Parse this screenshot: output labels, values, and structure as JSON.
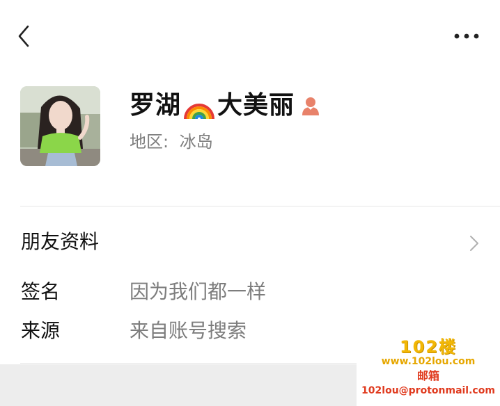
{
  "topbar": {
    "back_icon": "chevron-left-icon",
    "more_icon": "more-dots-icon"
  },
  "profile": {
    "nickname_part1": "罗湖",
    "nickname_emoji": "rainbow-icon",
    "nickname_part2": "大美丽",
    "gender_icon": "female-icon",
    "region_label": "地区:",
    "region_value": "冰岛"
  },
  "friend_info": {
    "title": "朋友资料"
  },
  "details": [
    {
      "label": "签名",
      "value": "因为我们都一样"
    },
    {
      "label": "来源",
      "value": "来自账号搜索"
    }
  ],
  "watermark": {
    "logo": "102楼",
    "site": "www.102lou.com",
    "mail_label": "邮箱",
    "mail": "102lou@protonmail.com"
  },
  "colors": {
    "text_primary": "#111111",
    "text_secondary": "#7d7d7d",
    "divider": "#e5e5e5",
    "band": "#ededed",
    "gender_icon": "#e8826a"
  }
}
